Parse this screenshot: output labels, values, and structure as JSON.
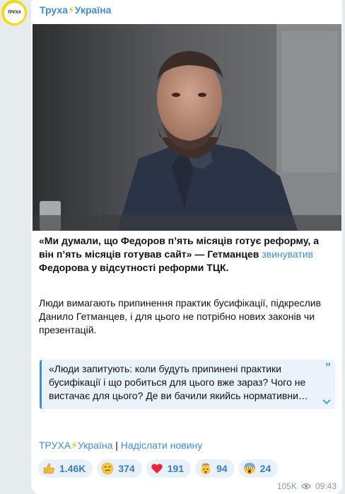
{
  "channel": {
    "name_part1": "Труха",
    "bolt": "⚡",
    "name_part2": "Україна",
    "avatar_text": "ТРУХА"
  },
  "post": {
    "headline": "«Ми думали, що Федоров п’ять місяців готує реформу, а він п’ять місяців готував сайт» — Гетманцев",
    "headline_link": "звинуватив",
    "headline_tail": "Федорова у відсутності реформи ТЦК.",
    "paragraph": "Люди вимагають припинення практик бусифікації, підкреслив Данило Гетманцев, і для цього не потрібно нових законів чи презентацій.",
    "quote_lines": [
      "«Люди запитують: коли будуть припинені практики",
      "бусифікації і що робиться для цього вже зараз? Чого не",
      "вистачає для цього? Де ви бачили якийсь нормативни…"
    ]
  },
  "footer": {
    "link1_part1": "ТРУХА",
    "link1_bolt": "⚡",
    "link1_part2": "Україна",
    "separator": "|",
    "link2": "Надіслати новину"
  },
  "reactions": [
    {
      "emoji": "thumbs-up",
      "count": "1.46K"
    },
    {
      "emoji": "smirk-face",
      "count": "374"
    },
    {
      "emoji": "red-heart",
      "count": "191"
    },
    {
      "emoji": "exploding-head",
      "count": "94"
    },
    {
      "emoji": "screaming-face",
      "count": "24"
    }
  ],
  "meta": {
    "views": "105K",
    "time": "09:43"
  }
}
